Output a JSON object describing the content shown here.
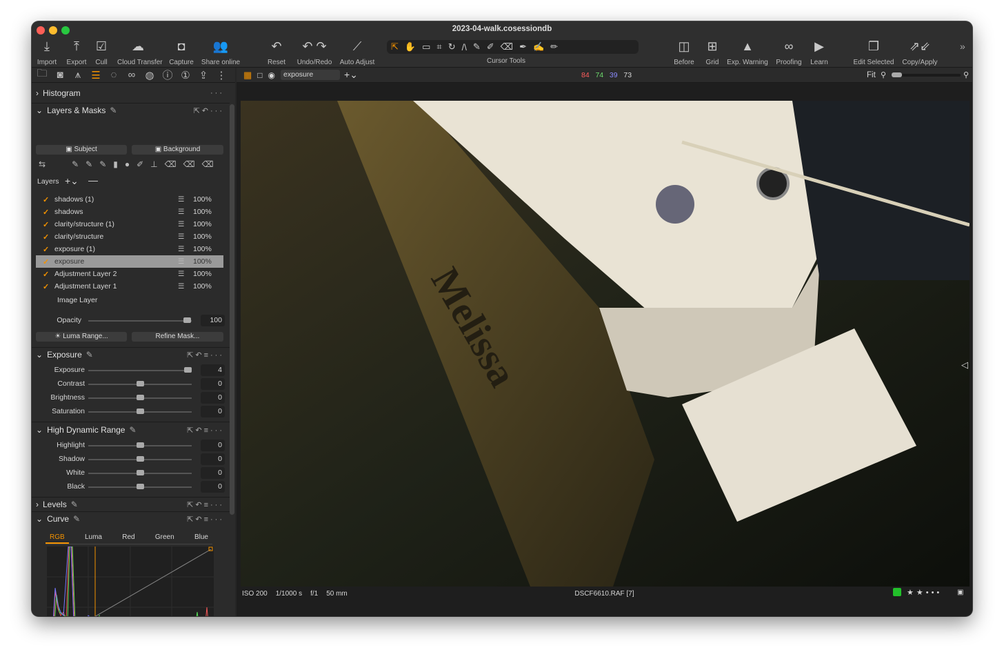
{
  "window": {
    "title": "2023-04-walk.cosessiondb"
  },
  "toolbar": {
    "left": [
      {
        "label": "Import",
        "icon": "import-icon"
      },
      {
        "label": "Export",
        "icon": "export-icon"
      },
      {
        "label": "Cull",
        "icon": "cull-icon"
      },
      {
        "label": "Cloud Transfer",
        "icon": "cloud-icon"
      },
      {
        "label": "Capture",
        "icon": "camera-icon"
      },
      {
        "label": "Share online",
        "icon": "people-icon"
      },
      {
        "label": "Reset",
        "icon": "reset-icon"
      },
      {
        "label": "Undo/Redo",
        "icon": "undo-icon"
      },
      {
        "label": "Auto Adjust",
        "icon": "wand-icon"
      }
    ],
    "cursor_tools_label": "Cursor Tools",
    "right": [
      {
        "label": "Before",
        "icon": "before-icon"
      },
      {
        "label": "Grid",
        "icon": "grid-icon"
      },
      {
        "label": "Exp. Warning",
        "icon": "warning-icon"
      },
      {
        "label": "Proofing",
        "icon": "glasses-icon"
      },
      {
        "label": "Learn",
        "icon": "learn-icon"
      },
      {
        "label": "Edit Selected",
        "icon": "edit-selected-icon"
      },
      {
        "label": "Copy/Apply",
        "icon": "copy-apply-icon"
      }
    ]
  },
  "viewer_bar": {
    "style_select": "exposure",
    "rgb": {
      "r": "84",
      "g": "74",
      "b": "39",
      "l": "73"
    },
    "zoom": "Fit",
    "colors": {
      "r": "#ff5c5c",
      "g": "#6ddc6d",
      "b": "#8c8cff"
    }
  },
  "panel": {
    "histogram": "Histogram",
    "layers_masks": "Layers & Masks",
    "subject_btn": "Subject",
    "background_btn": "Background",
    "layers_label": "Layers",
    "layers": [
      {
        "name": "shadows (1)",
        "opacity": "100%",
        "checked": true
      },
      {
        "name": "shadows",
        "opacity": "100%",
        "checked": true
      },
      {
        "name": "clarity/structure (1)",
        "opacity": "100%",
        "checked": true
      },
      {
        "name": "clarity/structure",
        "opacity": "100%",
        "checked": true
      },
      {
        "name": "exposure (1)",
        "opacity": "100%",
        "checked": true
      },
      {
        "name": "exposure",
        "opacity": "100%",
        "checked": true,
        "selected": true
      },
      {
        "name": "Adjustment Layer 2",
        "opacity": "100%",
        "checked": true
      },
      {
        "name": "Adjustment Layer 1",
        "opacity": "100%",
        "checked": true
      }
    ],
    "image_layer": "Image Layer",
    "opacity_label": "Opacity",
    "opacity_value": "100",
    "luma_btn": "Luma Range...",
    "refine_btn": "Refine Mask...",
    "exposure": {
      "title": "Exposure",
      "sliders": [
        {
          "label": "Exposure",
          "value": "4",
          "pos": 0.96
        },
        {
          "label": "Contrast",
          "value": "0",
          "pos": 0.5
        },
        {
          "label": "Brightness",
          "value": "0",
          "pos": 0.5
        },
        {
          "label": "Saturation",
          "value": "0",
          "pos": 0.5
        }
      ]
    },
    "hdr": {
      "title": "High Dynamic Range",
      "sliders": [
        {
          "label": "Highlight",
          "value": "0",
          "pos": 0.5
        },
        {
          "label": "Shadow",
          "value": "0",
          "pos": 0.5
        },
        {
          "label": "White",
          "value": "0",
          "pos": 0.5
        },
        {
          "label": "Black",
          "value": "0",
          "pos": 0.5
        }
      ]
    },
    "levels": "Levels",
    "curve": {
      "title": "Curve",
      "tabs": [
        "RGB",
        "Luma",
        "Red",
        "Green",
        "Blue"
      ],
      "active": "RGB"
    }
  },
  "status": {
    "iso": "ISO 200",
    "shutter": "1/1000 s",
    "aperture": "f/1",
    "focal": "50 mm",
    "filename": "DSCF6610.RAF [7]",
    "rating": 2,
    "color_tag": "#22c02a"
  }
}
